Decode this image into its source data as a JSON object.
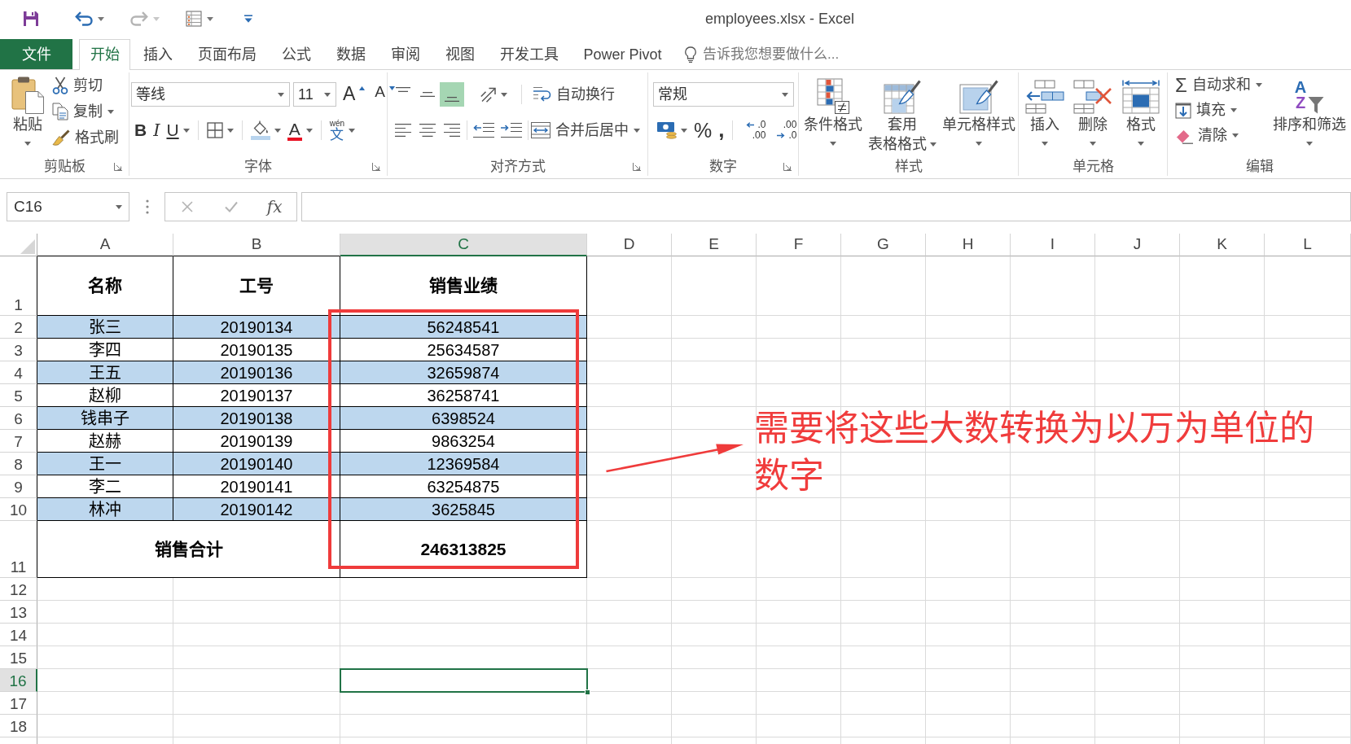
{
  "window": {
    "title": "employees.xlsx - Excel"
  },
  "quick_access": [
    {
      "kind": "save",
      "dropdown": false,
      "disabled": false
    },
    {
      "kind": "undo",
      "dropdown": true,
      "disabled": false
    },
    {
      "kind": "redo",
      "dropdown": true,
      "disabled": true
    },
    {
      "kind": "form",
      "dropdown": true,
      "disabled": false
    },
    {
      "kind": "customize",
      "dropdown": false,
      "disabled": false
    }
  ],
  "tabs": [
    {
      "label": "文件",
      "kind": "file",
      "selected": false
    },
    {
      "label": "开始",
      "kind": "tab",
      "selected": true
    },
    {
      "label": "插入",
      "kind": "tab",
      "selected": false
    },
    {
      "label": "页面布局",
      "kind": "tab",
      "selected": false
    },
    {
      "label": "公式",
      "kind": "tab",
      "selected": false
    },
    {
      "label": "数据",
      "kind": "tab",
      "selected": false
    },
    {
      "label": "审阅",
      "kind": "tab",
      "selected": false
    },
    {
      "label": "视图",
      "kind": "tab",
      "selected": false
    },
    {
      "label": "开发工具",
      "kind": "tab",
      "selected": false
    },
    {
      "label": "Power Pivot",
      "kind": "tab",
      "selected": false
    }
  ],
  "tell_me": {
    "placeholder": "告诉我您想要做什么..."
  },
  "ribbon": {
    "groups": [
      {
        "kind": "clipboard",
        "label": "剪贴板",
        "launcher": true,
        "large": [
          {
            "kind": "paste",
            "label": "粘贴",
            "dropdown": true
          }
        ],
        "small": [
          {
            "kind": "cut",
            "label": "剪切",
            "dropdown": false
          },
          {
            "kind": "copy",
            "label": "复制",
            "dropdown": true
          },
          {
            "kind": "format_painter",
            "label": "格式刷",
            "dropdown": false
          }
        ]
      },
      {
        "kind": "font",
        "label": "字体",
        "launcher": true,
        "font_name": "等线",
        "font_size": "11",
        "size_buttons": [
          {
            "kind": "grow_font",
            "label": "A"
          },
          {
            "kind": "shrink_font",
            "label": "A"
          }
        ],
        "format_buttons": [
          {
            "kind": "bold",
            "label": "B",
            "dropdown": false
          },
          {
            "kind": "italic",
            "label": "I",
            "dropdown": false
          },
          {
            "kind": "underline",
            "label": "U",
            "dropdown": true
          },
          {
            "kind": "borders",
            "dropdown": true
          },
          {
            "kind": "fill_color",
            "dropdown": true
          },
          {
            "kind": "font_color",
            "label": "A",
            "dropdown": true
          },
          {
            "kind": "phonetic",
            "ruby": "wén",
            "label": "文",
            "dropdown": true
          }
        ]
      },
      {
        "kind": "alignment",
        "label": "对齐方式",
        "launcher": true,
        "vertical_align": [
          {
            "kind": "top",
            "selected": false
          },
          {
            "kind": "middle",
            "selected": false
          },
          {
            "kind": "bottom",
            "selected": true
          }
        ],
        "orientation": {
          "dropdown": true
        },
        "horizontal_align": [
          {
            "kind": "left",
            "selected": false
          },
          {
            "kind": "center",
            "selected": false
          },
          {
            "kind": "right",
            "selected": false
          }
        ],
        "indent": [
          {
            "kind": "decrease"
          },
          {
            "kind": "increase"
          }
        ],
        "commands": [
          {
            "kind": "wrap_text",
            "label": "自动换行",
            "dropdown": false
          },
          {
            "kind": "merge_center",
            "label": "合并后居中",
            "dropdown": true
          }
        ]
      },
      {
        "kind": "number",
        "label": "数字",
        "launcher": true,
        "format": "常规",
        "buttons": [
          {
            "kind": "currency",
            "dropdown": true
          },
          {
            "kind": "percent",
            "label": "%"
          },
          {
            "kind": "comma",
            "label": ","
          },
          {
            "kind": "increase_decimal",
            "lines": [
              ".0",
              ".00"
            ]
          },
          {
            "kind": "decrease_decimal",
            "lines": [
              ".00",
              ".0"
            ]
          }
        ]
      },
      {
        "kind": "styles",
        "label": "样式",
        "launcher": false,
        "large": [
          {
            "kind": "conditional_format",
            "label": "条件格式",
            "dropdown": true
          },
          {
            "kind": "table_format",
            "label_lines": [
              "套用",
              "表格格式"
            ],
            "dropdown": true
          },
          {
            "kind": "cell_styles",
            "label": "单元格样式",
            "dropdown": true
          }
        ]
      },
      {
        "kind": "cells",
        "label": "单元格",
        "launcher": false,
        "large": [
          {
            "kind": "insert",
            "label": "插入",
            "dropdown": true
          },
          {
            "kind": "delete",
            "label": "删除",
            "dropdown": true
          },
          {
            "kind": "format",
            "label": "格式",
            "dropdown": true
          }
        ]
      },
      {
        "kind": "editing",
        "label": "编辑",
        "launcher": false,
        "small": [
          {
            "kind": "autosum",
            "symbol": "Σ",
            "label": "自动求和",
            "dropdown": true
          },
          {
            "kind": "fill",
            "label": "填充",
            "dropdown": true
          },
          {
            "kind": "clear",
            "label": "清除",
            "dropdown": true
          }
        ],
        "large": [
          {
            "kind": "sort_filter",
            "glyphs": [
              "A",
              "Z"
            ],
            "label": "排序和筛选",
            "dropdown": true
          }
        ]
      }
    ]
  },
  "formula_bar": {
    "name_box": "C16",
    "buttons": [
      {
        "kind": "cancel",
        "disabled": true
      },
      {
        "kind": "enter",
        "disabled": true
      },
      {
        "kind": "function",
        "label": "fx",
        "disabled": false
      }
    ]
  },
  "sheet": {
    "columns": [
      {
        "label": "A",
        "selected": false
      },
      {
        "label": "B",
        "selected": false
      },
      {
        "label": "C",
        "selected": true
      },
      {
        "label": "D",
        "selected": false
      },
      {
        "label": "E",
        "selected": false
      },
      {
        "label": "F",
        "selected": false
      },
      {
        "label": "G",
        "selected": false
      },
      {
        "label": "H",
        "selected": false
      },
      {
        "label": "I",
        "selected": false
      },
      {
        "label": "J",
        "selected": false
      },
      {
        "label": "K",
        "selected": false
      },
      {
        "label": "L",
        "selected": false
      }
    ],
    "rows": [
      {
        "label": "1",
        "selected": false
      },
      {
        "label": "2",
        "selected": false
      },
      {
        "label": "3",
        "selected": false
      },
      {
        "label": "4",
        "selected": false
      },
      {
        "label": "5",
        "selected": false
      },
      {
        "label": "6",
        "selected": false
      },
      {
        "label": "7",
        "selected": false
      },
      {
        "label": "8",
        "selected": false
      },
      {
        "label": "9",
        "selected": false
      },
      {
        "label": "10",
        "selected": false
      },
      {
        "label": "11",
        "selected": false
      },
      {
        "label": "12",
        "selected": false
      },
      {
        "label": "13",
        "selected": false
      },
      {
        "label": "14",
        "selected": false
      },
      {
        "label": "15",
        "selected": false
      },
      {
        "label": "16",
        "selected": true
      },
      {
        "label": "17",
        "selected": false
      },
      {
        "label": "18",
        "selected": false
      }
    ],
    "table": {
      "header": [
        "名称",
        "工号",
        "销售业绩"
      ],
      "records": [
        {
          "cells": [
            "张三",
            "20190134",
            "56248541"
          ],
          "shaded": true
        },
        {
          "cells": [
            "李四",
            "20190135",
            "25634587"
          ],
          "shaded": false
        },
        {
          "cells": [
            "王五",
            "20190136",
            "32659874"
          ],
          "shaded": true
        },
        {
          "cells": [
            "赵柳",
            "20190137",
            "36258741"
          ],
          "shaded": false
        },
        {
          "cells": [
            "钱串子",
            "20190138",
            "6398524"
          ],
          "shaded": true
        },
        {
          "cells": [
            "赵赫",
            "20190139",
            "9863254"
          ],
          "shaded": false
        },
        {
          "cells": [
            "王一",
            "20190140",
            "12369584"
          ],
          "shaded": true
        },
        {
          "cells": [
            "李二",
            "20190141",
            "63254875"
          ],
          "shaded": false
        },
        {
          "cells": [
            "林冲",
            "20190142",
            "3625845"
          ],
          "shaded": true
        }
      ],
      "total": {
        "label": "销售合计",
        "value": "246313825"
      }
    }
  },
  "annotation": {
    "text": "需要将这些大数转换为以万为单位的数字"
  }
}
